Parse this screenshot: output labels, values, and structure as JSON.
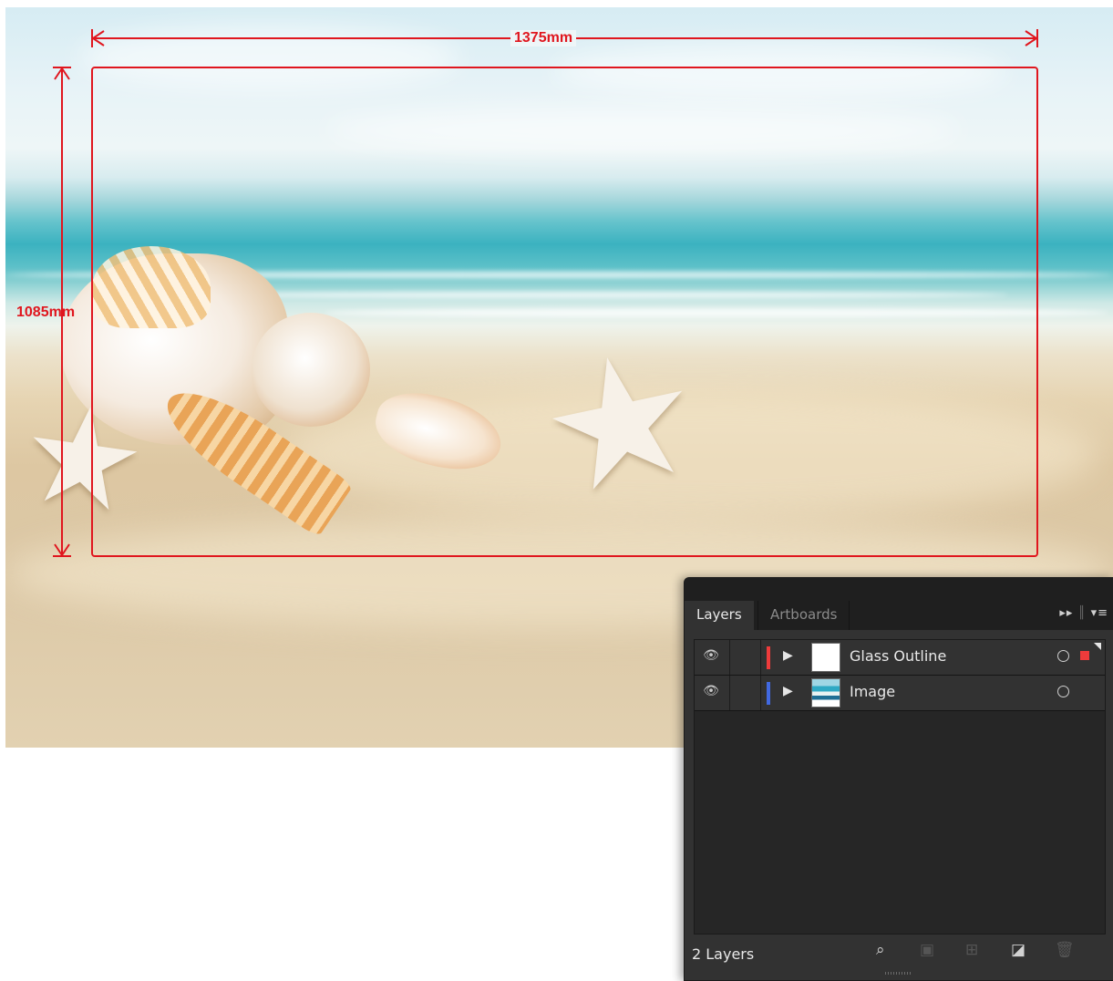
{
  "artwork": {
    "width_label": "1375mm",
    "height_label": "1085mm",
    "outline_color": "#e0161e"
  },
  "layers_panel": {
    "tabs": [
      {
        "label": "Layers",
        "active": true
      },
      {
        "label": "Artboards",
        "active": false
      }
    ],
    "header_icons": [
      "double-arrow-icon",
      "panel-menu-icon"
    ],
    "layers": [
      {
        "name": "Glass Outline",
        "color": "#ee3b3b",
        "visible": true,
        "selected_art": true
      },
      {
        "name": "Image",
        "color": "#4169e1",
        "visible": true,
        "selected_art": false
      }
    ],
    "status": "2 Layers",
    "footer_icons": [
      "search-icon",
      "clipping-mask-icon",
      "sublayer-icon",
      "new-layer-icon",
      "trash-icon"
    ]
  }
}
